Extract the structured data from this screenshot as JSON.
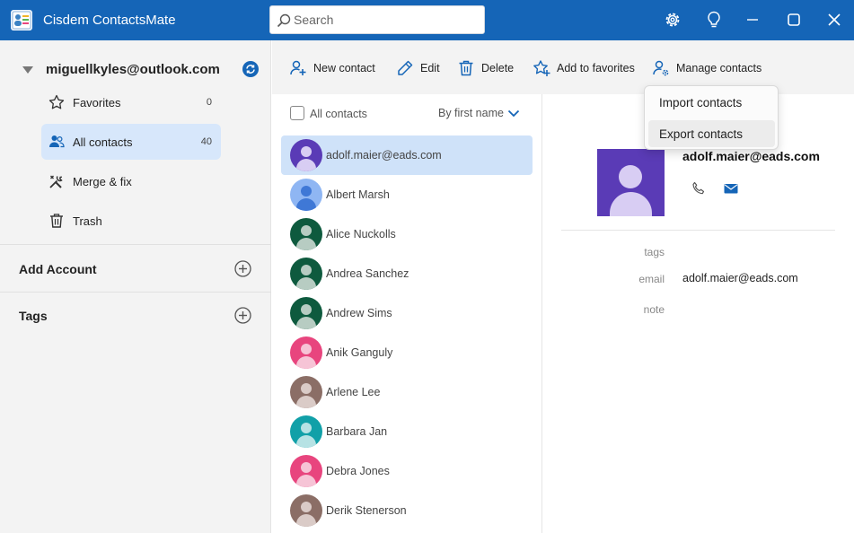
{
  "app": {
    "title": "Cisdem ContactsMate"
  },
  "search": {
    "placeholder": "Search"
  },
  "window_controls": [
    "settings-icon",
    "lightbulb-icon",
    "minimize-icon",
    "maximize-icon",
    "close-icon"
  ],
  "sidebar": {
    "account": "miguellkyles@outlook.com",
    "items": [
      {
        "label": "Favorites",
        "count": "0",
        "icon": "star-icon"
      },
      {
        "label": "All contacts",
        "count": "40",
        "icon": "people-icon",
        "active": true
      },
      {
        "label": "Merge & fix",
        "count": "",
        "icon": "tools-icon"
      },
      {
        "label": "Trash",
        "count": "",
        "icon": "trash-icon"
      }
    ],
    "sections": [
      {
        "label": "Add Account"
      },
      {
        "label": "Tags"
      }
    ]
  },
  "toolbar": {
    "new_contact": "New contact",
    "edit": "Edit",
    "delete": "Delete",
    "add_to_favorites": "Add to favorites",
    "manage_contacts": "Manage contacts"
  },
  "list": {
    "select_all_label": "All contacts",
    "sort_label": "By first name",
    "contacts": [
      {
        "name": "adolf.maier@eads.com",
        "color": "#5a3bb6",
        "light": "#d8cdf3",
        "selected": true
      },
      {
        "name": "Albert Marsh",
        "color": "#8fb6f3",
        "light": "#3f78d6"
      },
      {
        "name": "Alice Nuckolls",
        "color": "#0e5a3e",
        "light": "#b7ccc2"
      },
      {
        "name": "Andrea Sanchez",
        "color": "#0e5a3e",
        "light": "#b7ccc2"
      },
      {
        "name": "Andrew Sims",
        "color": "#0e5a3e",
        "light": "#b7ccc2"
      },
      {
        "name": "Anik Ganguly",
        "color": "#e8457e",
        "light": "#f6c4d6"
      },
      {
        "name": "Arlene Lee",
        "color": "#8b6e66",
        "light": "#dacbc7"
      },
      {
        "name": "Barbara Jan",
        "color": "#11a0a8",
        "light": "#b6e2e4"
      },
      {
        "name": "Debra Jones",
        "color": "#e8457e",
        "light": "#f6c4d6"
      },
      {
        "name": "Derik Stenerson",
        "color": "#8b6e66",
        "light": "#dacbc7"
      }
    ]
  },
  "detail": {
    "name": "adolf.maier@eads.com",
    "fields": [
      {
        "label": "tags",
        "value": ""
      },
      {
        "label": "email",
        "value": "adolf.maier@eads.com"
      },
      {
        "label": "note",
        "value": ""
      }
    ]
  },
  "menu": {
    "items": [
      "Import contacts",
      "Export contacts"
    ]
  },
  "colors": {
    "titlebar": "#1565b7",
    "accent": "#1565b7",
    "selected_row": "#cfe2f9"
  }
}
